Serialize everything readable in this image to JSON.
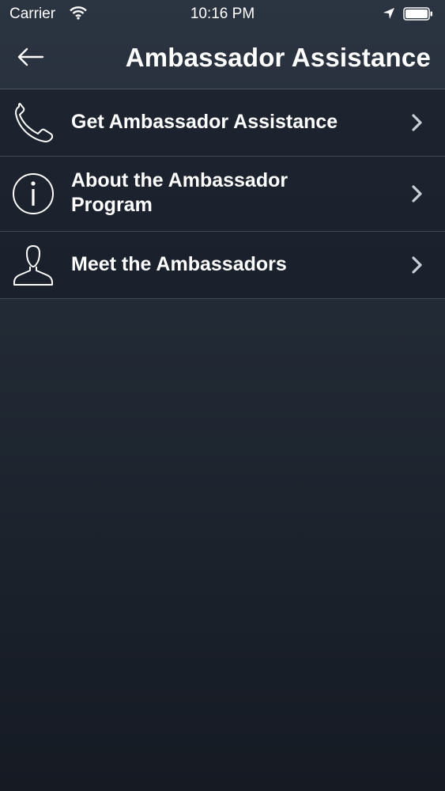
{
  "status_bar": {
    "carrier": "Carrier",
    "time": "10:16 PM",
    "icons": [
      "wifi-icon",
      "location-arrow-icon",
      "battery-icon"
    ]
  },
  "nav": {
    "title": "Ambassador Assistance",
    "back_icon": "back-arrow-icon"
  },
  "menu": {
    "items": [
      {
        "icon": "phone-icon",
        "label": "Get Ambassador Assistance"
      },
      {
        "icon": "info-icon",
        "label_line1": "About the Ambassador",
        "label_line2": "Program"
      },
      {
        "icon": "person-icon",
        "label": "Meet the Ambassadors"
      }
    ],
    "chevron_icon": "chevron-right-icon"
  },
  "colors": {
    "background_top": "#2b3441",
    "background_bottom": "#151a23",
    "text": "#ffffff",
    "chevron": "#c9ced6"
  }
}
